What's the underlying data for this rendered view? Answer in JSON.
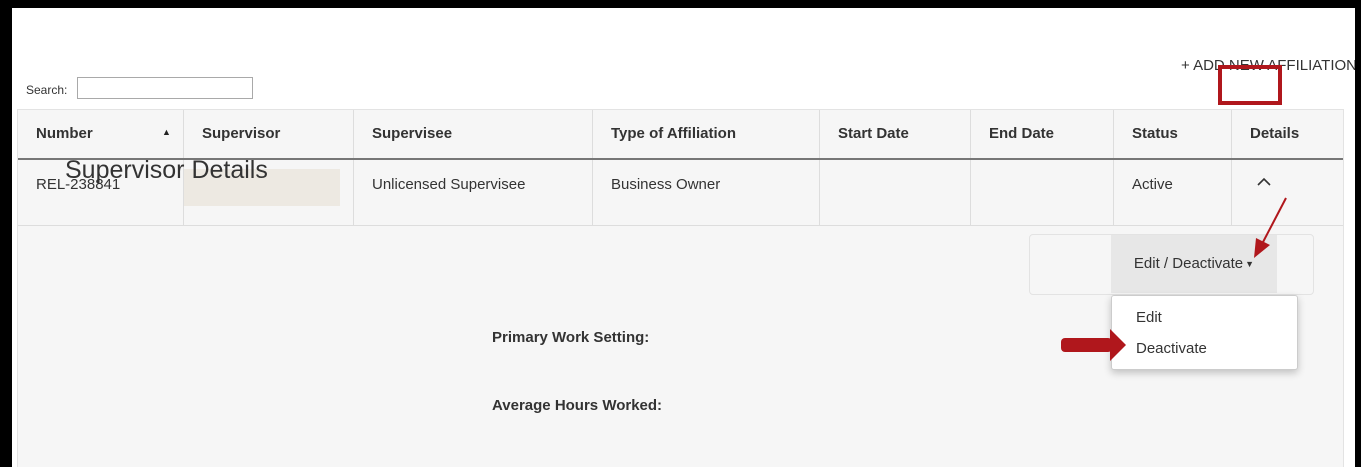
{
  "header": {
    "add_link": "+ ADD NEW AFFILIATION"
  },
  "search": {
    "label": "Search:",
    "value": "",
    "placeholder": ""
  },
  "table": {
    "columns": [
      "Number",
      "Supervisor",
      "Supervisee",
      "Type of Affiliation",
      "Start Date",
      "End Date",
      "Status",
      "Details"
    ],
    "sort_indicator": "ascending",
    "rows": [
      {
        "number": "REL-238841",
        "supervisor": "",
        "supervisee": "Unlicensed Supervisee",
        "type": "Business Owner",
        "start": "",
        "end": "",
        "status": "Active",
        "details_icon": "chevron-up-icon"
      }
    ]
  },
  "details": {
    "title": "Supervisor Details",
    "primary_work_setting_label": "Primary Work Setting:",
    "average_hours_label": "Average Hours Worked:"
  },
  "actions": {
    "dropdown_label": "Edit / Deactivate",
    "menu_items": [
      "Edit",
      "Deactivate"
    ]
  },
  "colors": {
    "annotation": "#b0171c",
    "panel_background": "#f6f6f6",
    "header_border": "#777777"
  }
}
